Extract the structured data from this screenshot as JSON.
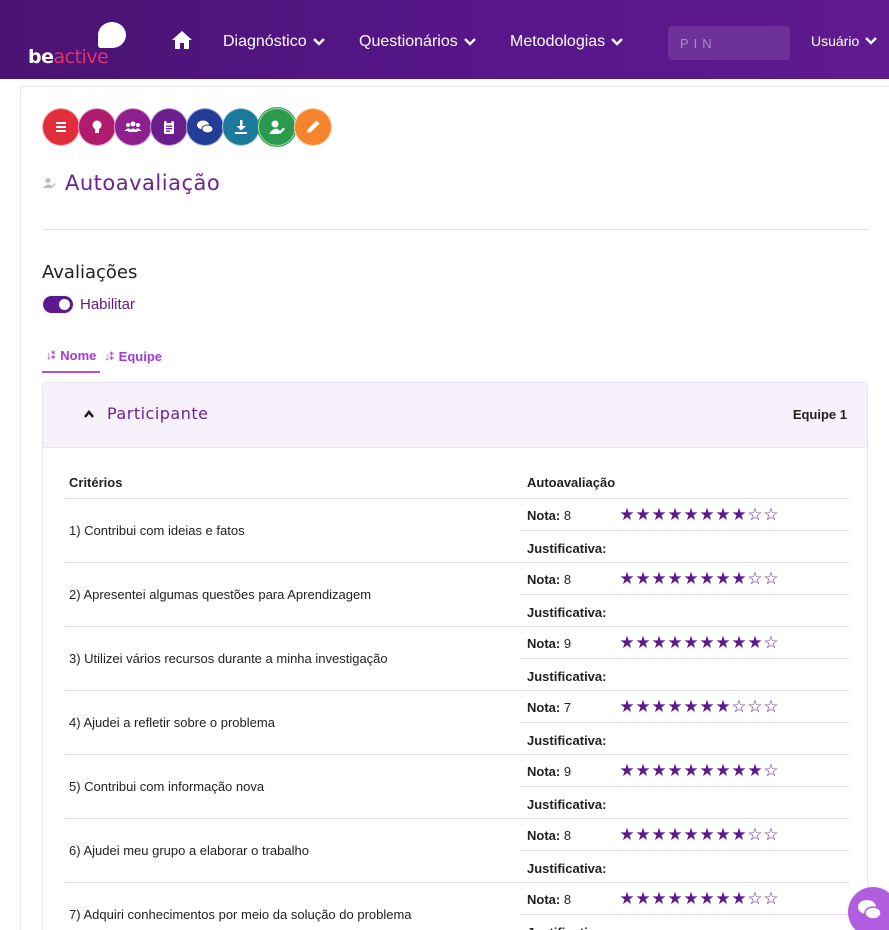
{
  "nav": {
    "logo_be": "be",
    "logo_active": "active",
    "items": [
      {
        "label": "Diagnóstico"
      },
      {
        "label": "Questionários"
      },
      {
        "label": "Metodologias"
      }
    ],
    "pin_placeholder": "PIN",
    "user_label": "Usuário"
  },
  "toolbar": {
    "circles": [
      {
        "icon": "list-icon",
        "color": "#e02f3a"
      },
      {
        "icon": "lightbulb-icon",
        "color": "#b11b6e"
      },
      {
        "icon": "users-icon",
        "color": "#8d1f8f"
      },
      {
        "icon": "clipboard-icon",
        "color": "#6b1d8c"
      },
      {
        "icon": "chat-icon",
        "color": "#233d97"
      },
      {
        "icon": "download-icon",
        "color": "#1b7a9c"
      },
      {
        "icon": "user-edit-icon",
        "color": "#2a9a4c"
      },
      {
        "icon": "pencil-icon",
        "color": "#f5842c"
      }
    ]
  },
  "page": {
    "title": "Autoavaliação",
    "section_title": "Avaliações",
    "toggle_label": "Habilitar",
    "sort_name": "Nome",
    "sort_team": "Equipe"
  },
  "accordion": {
    "title": "Participante",
    "team": "Equipe 1",
    "col_criteria": "Critérios",
    "col_self": "Autoavaliação",
    "nota_label": "Nota:",
    "just_label": "Justificativa:",
    "rows": [
      {
        "text": "1) Contribui com ideias e fatos",
        "nota": "8",
        "score": 8
      },
      {
        "text": "2) Apresentei algumas questões para Aprendizagem",
        "nota": "8",
        "score": 8
      },
      {
        "text": "3) Utilizei vários recursos durante a minha investigação",
        "nota": "9",
        "score": 9
      },
      {
        "text": "4) Ajudei a refletir sobre o problema",
        "nota": "7",
        "score": 7
      },
      {
        "text": "5) Contribui com informação nova",
        "nota": "9",
        "score": 9
      },
      {
        "text": "6) Ajudei meu grupo a elaborar o trabalho",
        "nota": "8",
        "score": 8
      },
      {
        "text": "7) Adquiri conhecimentos por meio da solução do problema",
        "nota": "8",
        "score": 8
      }
    ],
    "max_score": 10
  },
  "colors": {
    "brand_purple": "#5c1a8e",
    "accent_pink": "#e8306b",
    "sort_accent": "#a13bd6"
  }
}
